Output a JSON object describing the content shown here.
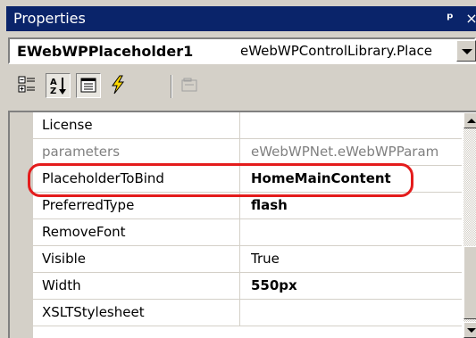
{
  "window": {
    "title": "Properties",
    "pin_glyph": "ऄ",
    "close_glyph": "✕"
  },
  "object_selector": {
    "name": "EWebWPPlaceholder1",
    "type": "eWebWPControlLibrary.Place"
  },
  "toolbar": {
    "buttons": [
      "categorized-icon",
      "alphabetical-icon",
      "properties-icon",
      "events-icon",
      "property-pages-icon"
    ],
    "pressed": [
      "alphabetical-icon",
      "properties-icon"
    ]
  },
  "properties": [
    {
      "name": "License",
      "value": "",
      "bold": false,
      "gray": false
    },
    {
      "name": "parameters",
      "value": "eWebWPNet.eWebWPParam",
      "bold": false,
      "gray": true
    },
    {
      "name": "PlaceholderToBind",
      "value": "HomeMainContent",
      "bold": true,
      "gray": false
    },
    {
      "name": "PreferredType",
      "value": "flash",
      "bold": true,
      "gray": false
    },
    {
      "name": "RemoveFont",
      "value": "",
      "bold": false,
      "gray": false
    },
    {
      "name": "Visible",
      "value": "True",
      "bold": false,
      "gray": false
    },
    {
      "name": "Width",
      "value": "550px",
      "bold": true,
      "gray": false
    },
    {
      "name": "XSLTStylesheet",
      "value": "",
      "bold": false,
      "gray": false
    }
  ],
  "highlight_color": "#e41c1c",
  "title_bar_color": "#0a246a"
}
